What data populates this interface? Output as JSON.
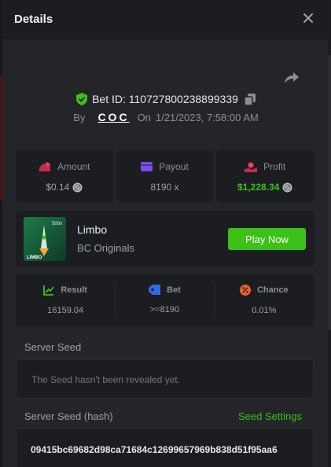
{
  "header": {
    "title": "Details"
  },
  "bet": {
    "id_label": "Bet ID: 110727800238899339",
    "by_label": "By",
    "user": "COC",
    "on_label": "On",
    "datetime": "1/21/2023, 7:58:00 AM"
  },
  "stats": [
    {
      "label": "Amount",
      "value": "$0.14",
      "color": "#c72c4f",
      "icon": "amount-icon"
    },
    {
      "label": "Payout",
      "value": "8190 x",
      "color": "#7b4de8",
      "icon": "wallet-icon"
    },
    {
      "label": "Profit",
      "value": "$1,228.34",
      "color": "#c72c4f",
      "icon": "profit-icon"
    }
  ],
  "game": {
    "name": "Limbo",
    "provider": "BC Originals",
    "play_label": "Play Now",
    "thumb_text": "LIMBO",
    "thumb_multiplier": "500x"
  },
  "result": [
    {
      "label": "Result",
      "value": "16159.04",
      "icon": "chart-icon"
    },
    {
      "label": "Bet",
      "value": ">=8190",
      "icon": "tag-icon"
    },
    {
      "label": "Chance",
      "value": "0.01%",
      "icon": "percent-icon"
    }
  ],
  "server_seed": {
    "label": "Server Seed",
    "message": "The Seed hasn't been revealed yet."
  },
  "server_seed_hash": {
    "label": "Server Seed (hash)",
    "settings_label": "Seed Settings",
    "value": "09415bc69682d98ca71684c12699657969b838d51f95aa6"
  },
  "colors": {
    "accent": "#3bc117",
    "background": "#232529",
    "card": "#1c1d21"
  }
}
